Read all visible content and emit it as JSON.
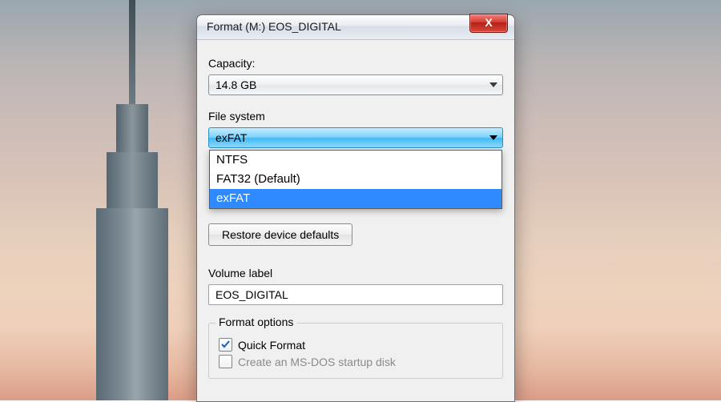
{
  "window": {
    "title": "Format (M:) EOS_DIGITAL",
    "close_glyph": "X"
  },
  "capacity": {
    "label": "Capacity:",
    "value": "14.8 GB"
  },
  "filesystem": {
    "label": "File system",
    "value": "exFAT",
    "options": [
      "NTFS",
      "FAT32 (Default)",
      "exFAT"
    ],
    "selected_index": 2
  },
  "restore_button_label": "Restore device defaults",
  "volume": {
    "label": "Volume label",
    "value": "EOS_DIGITAL"
  },
  "format_options": {
    "legend": "Format options",
    "quick_format": {
      "label": "Quick Format",
      "checked": true
    },
    "msdos": {
      "label": "Create an MS-DOS startup disk",
      "checked": false,
      "disabled": true
    }
  }
}
